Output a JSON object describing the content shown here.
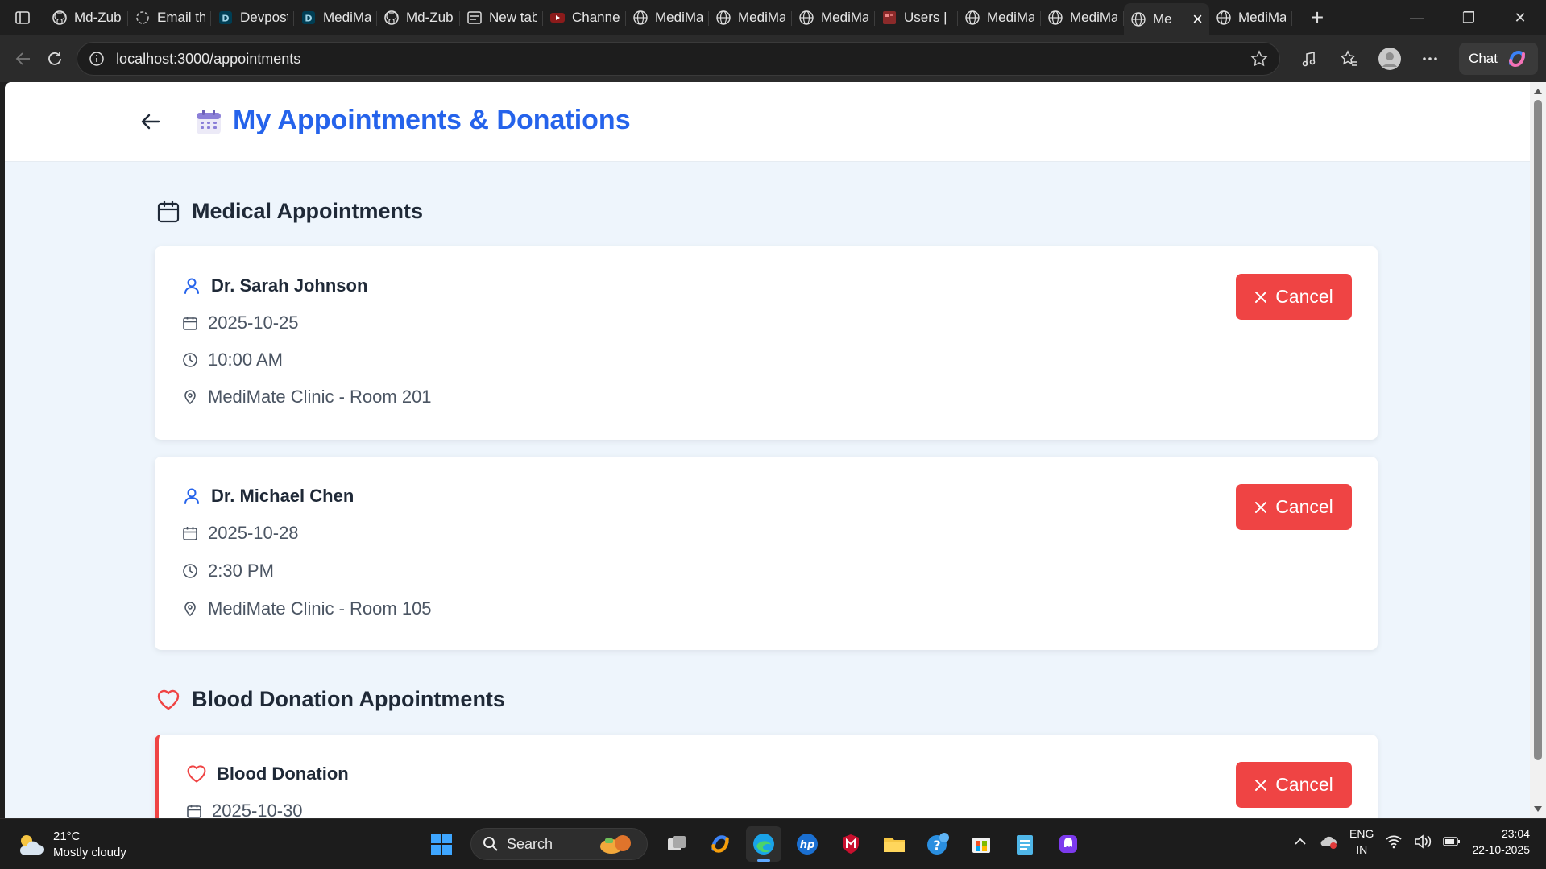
{
  "browser": {
    "tabs": [
      {
        "title": "Md-Zub",
        "icon": "github-icon"
      },
      {
        "title": "Email th",
        "icon": "openai-icon"
      },
      {
        "title": "Devpost",
        "icon": "devpost-icon"
      },
      {
        "title": "MediMa",
        "icon": "devpost-icon"
      },
      {
        "title": "Md-Zub",
        "icon": "github-icon"
      },
      {
        "title": "New tab",
        "icon": "newtab-icon"
      },
      {
        "title": "Channe",
        "icon": "youtube-icon"
      },
      {
        "title": "MediMa",
        "icon": "globe-icon"
      },
      {
        "title": "MediMa",
        "icon": "globe-icon"
      },
      {
        "title": "MediMa",
        "icon": "globe-icon"
      },
      {
        "title": "Users |",
        "icon": "users-icon"
      },
      {
        "title": "MediMa",
        "icon": "globe-icon"
      },
      {
        "title": "MediMa",
        "icon": "globe-icon"
      },
      {
        "title": "Me",
        "icon": "globe-icon",
        "active": true
      },
      {
        "title": "MediMa",
        "icon": "globe-icon"
      }
    ],
    "url": "localhost:3000/appointments",
    "chat_label": "Chat"
  },
  "page": {
    "title": "My Appointments & Donations",
    "medical_section_title": "Medical Appointments",
    "blood_section_title": "Blood Donation Appointments",
    "cancel_label": "Cancel",
    "appointments": [
      {
        "doctor": "Dr. Sarah Johnson",
        "date": "2025-10-25",
        "time": "10:00 AM",
        "location": "MediMate Clinic - Room 201"
      },
      {
        "doctor": "Dr. Michael Chen",
        "date": "2025-10-28",
        "time": "2:30 PM",
        "location": "MediMate Clinic - Room 105"
      }
    ],
    "donations": [
      {
        "title": "Blood Donation",
        "date": "2025-10-30"
      }
    ],
    "colors": {
      "accent": "#2563eb",
      "danger": "#ef4444",
      "background": "#eef5fc"
    }
  },
  "taskbar": {
    "temperature": "21°C",
    "weather": "Mostly cloudy",
    "search_placeholder": "Search",
    "lang_line1": "ENG",
    "lang_line2": "IN",
    "time": "23:04",
    "date": "22-10-2025"
  }
}
